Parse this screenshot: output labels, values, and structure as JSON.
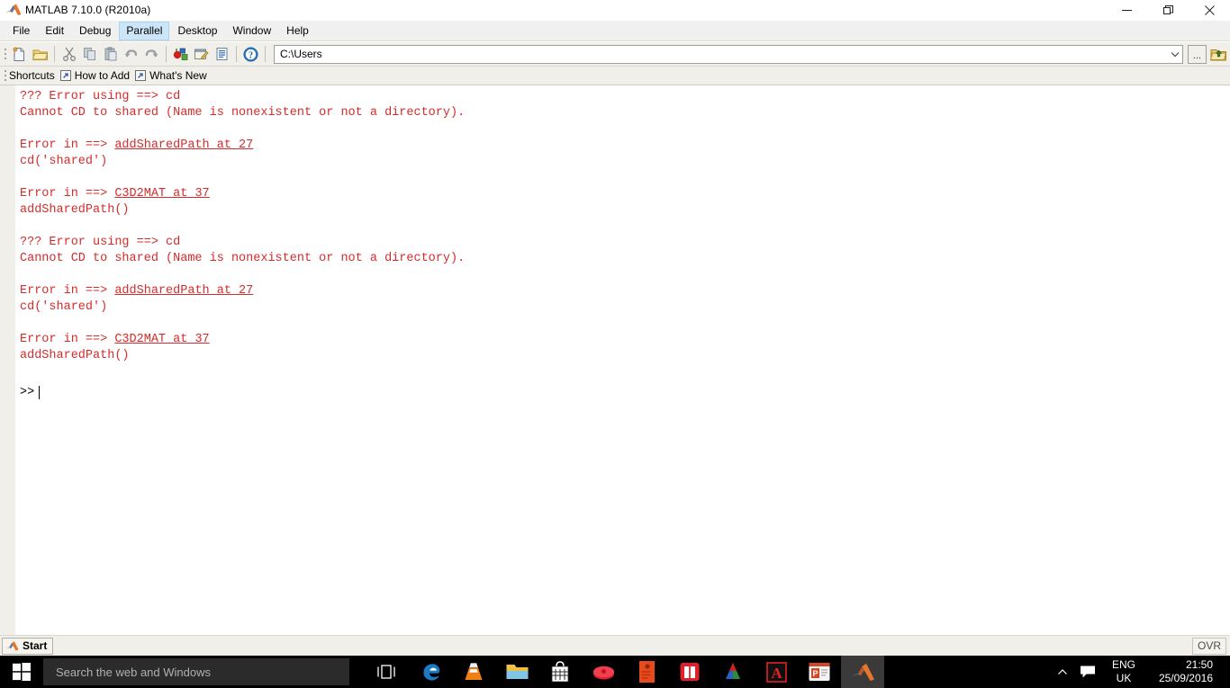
{
  "window": {
    "title": "MATLAB  7.10.0 (R2010a)",
    "logo_icon": "matlab-logo-icon",
    "controls": {
      "minimize": "minimize-icon",
      "restore": "restore-icon",
      "close": "close-icon"
    }
  },
  "menubar": {
    "items": [
      {
        "label": "File",
        "active": false
      },
      {
        "label": "Edit",
        "active": false
      },
      {
        "label": "Debug",
        "active": false
      },
      {
        "label": "Parallel",
        "active": true
      },
      {
        "label": "Desktop",
        "active": false
      },
      {
        "label": "Window",
        "active": false
      },
      {
        "label": "Help",
        "active": false
      }
    ]
  },
  "toolbar": {
    "buttons": [
      {
        "name": "new-file-icon",
        "tip": "New"
      },
      {
        "name": "open-folder-icon",
        "tip": "Open"
      },
      {
        "name": "cut-icon",
        "tip": "Cut"
      },
      {
        "name": "copy-icon",
        "tip": "Copy"
      },
      {
        "name": "paste-icon",
        "tip": "Paste"
      },
      {
        "name": "undo-icon",
        "tip": "Undo"
      },
      {
        "name": "redo-icon",
        "tip": "Redo"
      },
      {
        "name": "simulink-icon",
        "tip": "Simulink Library"
      },
      {
        "name": "guide-icon",
        "tip": "GUIDE"
      },
      {
        "name": "profiler-icon",
        "tip": "Profiler"
      },
      {
        "name": "help-icon",
        "tip": "Help"
      }
    ],
    "address": {
      "value": "C:\\Users",
      "placeholder": "",
      "chevron_icon": "chevron-down-icon",
      "browse_label": "...",
      "up_icon": "up-one-level-icon"
    }
  },
  "shortcutbar": {
    "shortcuts_label": "Shortcuts",
    "items": [
      {
        "icon": "shortcut-arrow-icon",
        "label": "How to Add"
      },
      {
        "icon": "shortcut-arrow-icon",
        "label": "What's New"
      }
    ]
  },
  "console": {
    "lines": [
      {
        "text": "??? Error using ==> cd",
        "style": "err"
      },
      {
        "text": "Cannot CD to shared (Name is nonexistent or not a directory).",
        "style": "err"
      },
      {
        "text": "",
        "style": "blank"
      },
      {
        "text": "Error in ==> ",
        "style": "err",
        "link": "addSharedPath at 27"
      },
      {
        "text": "cd('shared')",
        "style": "err"
      },
      {
        "text": "",
        "style": "blank"
      },
      {
        "text": "Error in ==> ",
        "style": "err",
        "link": "C3D2MAT at 37"
      },
      {
        "text": "addSharedPath()",
        "style": "err"
      },
      {
        "text": "",
        "style": "blank"
      },
      {
        "text": "??? Error using ==> cd",
        "style": "err"
      },
      {
        "text": "Cannot CD to shared (Name is nonexistent or not a directory).",
        "style": "err"
      },
      {
        "text": "",
        "style": "blank"
      },
      {
        "text": "Error in ==> ",
        "style": "err",
        "link": "addSharedPath at 27"
      },
      {
        "text": "cd('shared')",
        "style": "err"
      },
      {
        "text": "",
        "style": "blank"
      },
      {
        "text": "Error in ==> ",
        "style": "err",
        "link": "C3D2MAT at 37"
      },
      {
        "text": "addSharedPath()",
        "style": "err"
      }
    ],
    "prompt": ">>",
    "prompt_icon": "fx-function-browser-icon",
    "error_color": "#d42c2c",
    "text_color": "#000000",
    "background": "#ffffff"
  },
  "statusbar": {
    "start_label": "Start",
    "start_icon": "matlab-logo-icon",
    "overwrite_mode": "OVR"
  },
  "taskbar": {
    "start_icon": "windows-start-icon",
    "search_placeholder": "Search the web and Windows",
    "search_value": "",
    "taskview_icon": "task-view-icon",
    "apps": [
      {
        "name": "edge-icon",
        "label": "Microsoft Edge",
        "active": false
      },
      {
        "name": "vlc-icon",
        "label": "VLC Media Player",
        "active": false
      },
      {
        "name": "file-explorer-icon",
        "label": "File Explorer",
        "active": false
      },
      {
        "name": "store-icon",
        "label": "Store",
        "active": false
      },
      {
        "name": "mendeley-icon",
        "label": "Mendeley",
        "active": false
      },
      {
        "name": "zotero-icon",
        "label": "Zotero",
        "active": false
      },
      {
        "name": "book-icon",
        "label": "Reader",
        "active": false
      },
      {
        "name": "drive-icon",
        "label": "Google Drive",
        "active": false
      },
      {
        "name": "acrobat-icon",
        "label": "Adobe Acrobat",
        "active": false
      },
      {
        "name": "powerpoint-icon",
        "label": "PowerPoint",
        "active": false
      },
      {
        "name": "matlab-icon",
        "label": "MATLAB",
        "active": true
      }
    ],
    "tray": {
      "chevron_icon": "show-hidden-icons-icon",
      "action_center_icon": "action-center-icon",
      "language_line1": "ENG",
      "language_line2": "UK",
      "time": "21:50",
      "date": "25/09/2016"
    }
  }
}
